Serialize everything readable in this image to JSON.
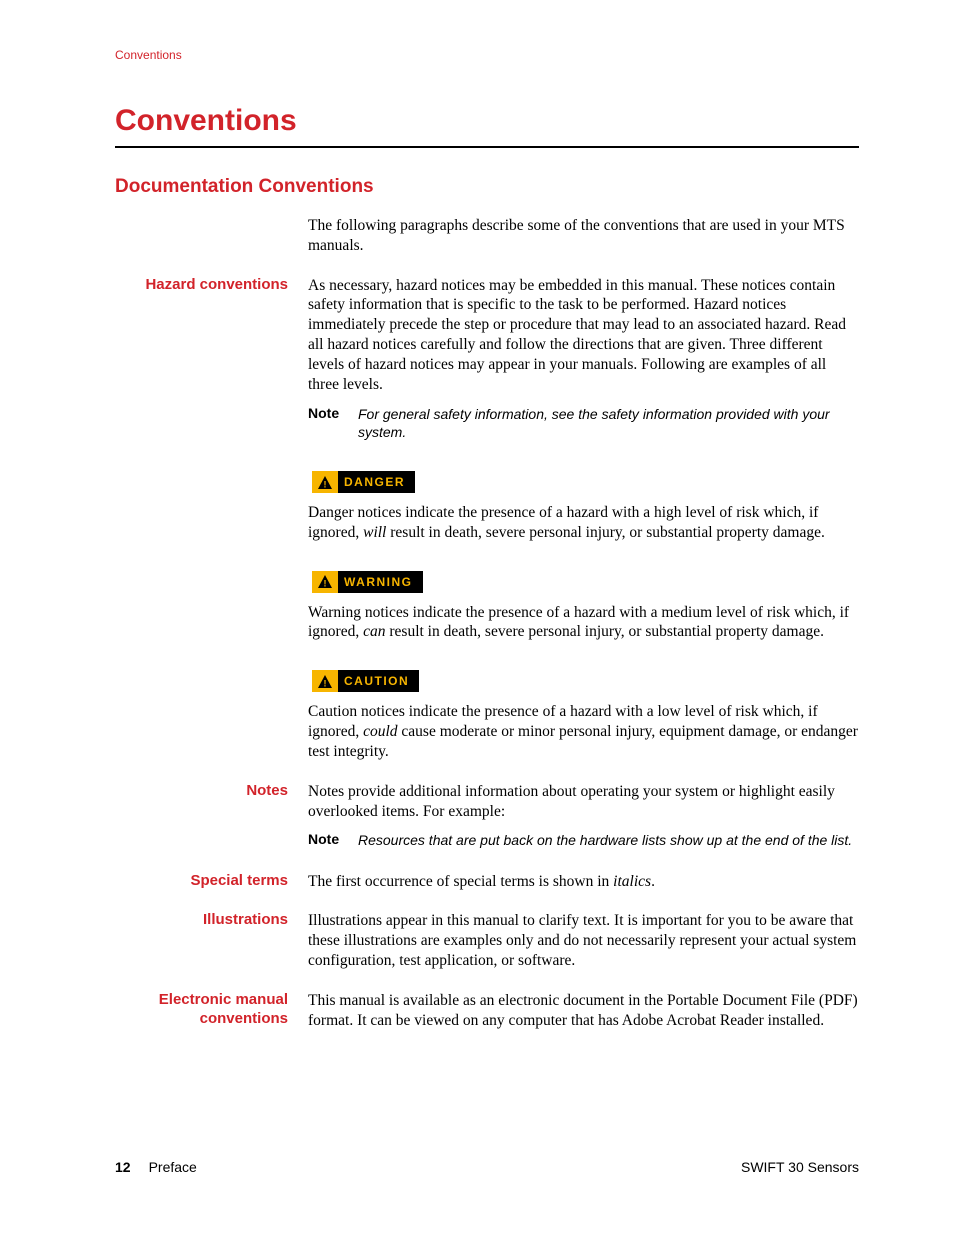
{
  "runningHead": "Conventions",
  "h1": "Conventions",
  "h2": "Documentation Conventions",
  "intro": "The following paragraphs describe some of the conventions that are used in your MTS manuals.",
  "sections": {
    "hazard": {
      "label": "Hazard conventions",
      "body": "As necessary, hazard notices may be embedded in this manual. These notices contain safety information that is specific to the task to be performed. Hazard notices immediately precede the step or procedure that may lead to an associated hazard. Read all hazard notices carefully and follow the directions that are given. Three different levels of hazard notices may appear in your manuals. Following are examples of all three levels."
    },
    "note1": {
      "label": "Note",
      "text": "For general safety information, see the safety information provided with your system."
    },
    "danger": {
      "badge": "DANGER",
      "text1": "Danger notices indicate the presence of a hazard with a high level of risk which, if ignored, ",
      "em": "will",
      "text2": " result in death, severe personal injury, or substantial property damage."
    },
    "warning": {
      "badge": "WARNING",
      "text1": "Warning notices indicate the presence of a hazard with a medium level of risk which, if ignored, ",
      "em": "can",
      "text2": " result in death, severe personal injury, or substantial property damage."
    },
    "caution": {
      "badge": "CAUTION",
      "text1": "Caution notices indicate the presence of a hazard with a low level of risk which, if ignored, ",
      "em": "could",
      "text2": " cause moderate or minor personal injury, equipment damage, or endanger test integrity."
    },
    "notes": {
      "label": "Notes",
      "body": "Notes provide additional information about operating your system or highlight easily overlooked items. For example:"
    },
    "note2": {
      "label": "Note",
      "text": "Resources that are put back on the hardware lists show up at the end of the list."
    },
    "special": {
      "label": "Special terms",
      "text1": "The first occurrence of special terms is shown in ",
      "em": "italics",
      "text2": "."
    },
    "illus": {
      "label": "Illustrations",
      "body": "Illustrations appear in this manual to clarify text. It is important for you to be aware that these illustrations are examples only and do not necessarily represent your actual system configuration, test application, or software."
    },
    "emanual": {
      "label": "Electronic manual conventions",
      "body": "This manual is available as an electronic document in the Portable Document File (PDF) format. It can be viewed on any computer that has Adobe Acrobat Reader installed."
    }
  },
  "footer": {
    "page": "12",
    "section": "Preface",
    "docTitle": "SWIFT 30 Sensors"
  }
}
